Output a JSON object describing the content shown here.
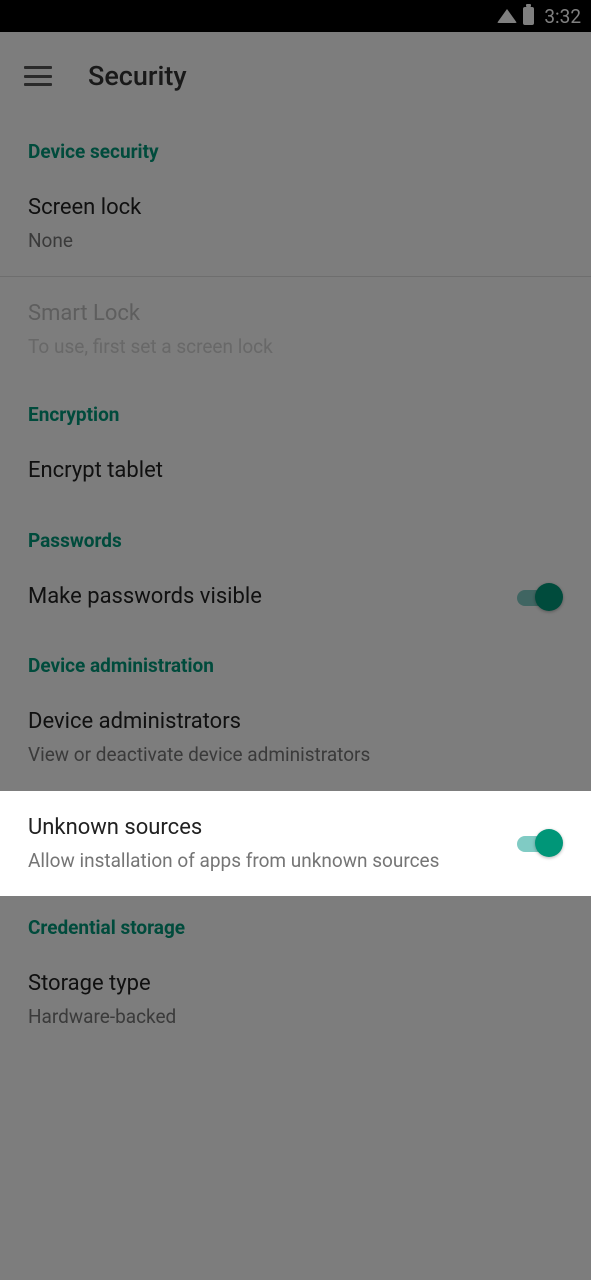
{
  "statusBar": {
    "time": "3:32"
  },
  "appBar": {
    "title": "Security"
  },
  "sections": {
    "deviceSecurity": {
      "header": "Device security"
    },
    "encryption": {
      "header": "Encryption"
    },
    "passwords": {
      "header": "Passwords"
    },
    "deviceAdmin": {
      "header": "Device administration"
    },
    "credentialStorage": {
      "header": "Credential storage"
    }
  },
  "items": {
    "screenLock": {
      "title": "Screen lock",
      "sub": "None"
    },
    "smartLock": {
      "title": "Smart Lock",
      "sub": "To use, first set a screen lock"
    },
    "encryptTablet": {
      "title": "Encrypt tablet"
    },
    "makePasswordsVisible": {
      "title": "Make passwords visible"
    },
    "deviceAdministrators": {
      "title": "Device administrators",
      "sub": "View or deactivate device administrators"
    },
    "unknownSources": {
      "title": "Unknown sources",
      "sub": "Allow installation of apps from unknown sources"
    },
    "storageType": {
      "title": "Storage type",
      "sub": "Hardware-backed"
    }
  },
  "colors": {
    "accent": "#009678"
  }
}
